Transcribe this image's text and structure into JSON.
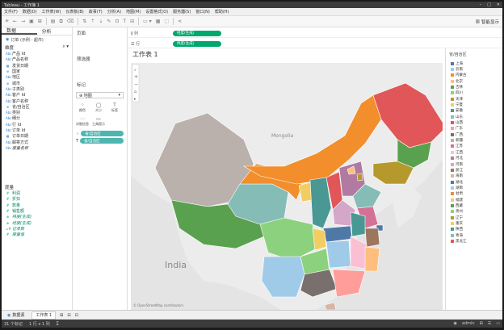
{
  "window": {
    "title": "Tableau - 工作簿 1",
    "controls": [
      "–",
      "□",
      "✕"
    ]
  },
  "menu": [
    "文件(F)",
    "数据(D)",
    "工作表(W)",
    "仪表板(B)",
    "故事(T)",
    "分析(A)",
    "地图(M)",
    "设置格式(O)",
    "服务器(S)",
    "窗口(N)",
    "帮助(H)"
  ],
  "toolbar": {
    "smart_show": "智能显示"
  },
  "data_pane": {
    "tab_data": "数据",
    "tab_analysis": "分析",
    "source": "订单 (示例 - 超市)",
    "dimensions_label": "维度",
    "dimensions": [
      {
        "name": "产品 Id",
        "icon": "Abc"
      },
      {
        "name": "产品名称",
        "icon": "Abc"
      },
      {
        "name": "发货日期",
        "icon": "▦"
      },
      {
        "name": "国家",
        "icon": "⊕"
      },
      {
        "name": "地区",
        "icon": "Abc"
      },
      {
        "name": "城市",
        "icon": "⊕"
      },
      {
        "name": "子类别",
        "icon": "Abc"
      },
      {
        "name": "客户 Id",
        "icon": "Abc"
      },
      {
        "name": "客户名称",
        "icon": "Abc"
      },
      {
        "name": "省/自治区",
        "icon": "⊕"
      },
      {
        "name": "类别",
        "icon": "Abc"
      },
      {
        "name": "细分",
        "icon": "Abc"
      },
      {
        "name": "行 Id",
        "icon": "Abc"
      },
      {
        "name": "订单 Id",
        "icon": "Abc"
      },
      {
        "name": "订单日期",
        "icon": "▦"
      },
      {
        "name": "邮寄方式",
        "icon": "Abc"
      },
      {
        "name": "度量名称",
        "icon": "Abc",
        "italic": true
      }
    ],
    "measures_label": "度量",
    "measures": [
      {
        "name": "利润",
        "icon": "#"
      },
      {
        "name": "折扣",
        "icon": "#"
      },
      {
        "name": "数量",
        "icon": "#"
      },
      {
        "name": "销售额",
        "icon": "#"
      },
      {
        "name": "纬度(生成)",
        "icon": "⊕",
        "italic": true
      },
      {
        "name": "经度(生成)",
        "icon": "⊕",
        "italic": true
      },
      {
        "name": "记录数",
        "icon": "=#",
        "italic": true
      },
      {
        "name": "度量值",
        "icon": "#",
        "italic": true
      }
    ]
  },
  "shelves": {
    "pages_label": "页面",
    "columns_label": "列",
    "columns_pill": "经度(生成)",
    "rows_label": "行",
    "rows_pill": "纬度(生成)",
    "filters_label": "筛选器",
    "marks_label": "标记",
    "marks_type": "地图",
    "mark_buttons": [
      {
        "label": "颜色",
        "icon": "⁘"
      },
      {
        "label": "大小",
        "icon": "◯"
      },
      {
        "label": "标签",
        "icon": "T"
      },
      {
        "label": "详细信息",
        "icon": "⋯"
      },
      {
        "label": "工具提示",
        "icon": "▭"
      }
    ],
    "mark_pills": [
      {
        "name": "省/自治区",
        "icon": "⁘"
      },
      {
        "name": "省/自治区",
        "icon": "T"
      }
    ]
  },
  "sheet": {
    "title": "工作表 1",
    "copyright": "© OpenStreetMap contributors"
  },
  "map_labels": {
    "mongolia": "Mongolia",
    "india": "India"
  },
  "legend": {
    "title": "省/自治区",
    "items": [
      {
        "name": "上海",
        "color": "#4e79a7"
      },
      {
        "name": "云南",
        "color": "#a0cbe8"
      },
      {
        "name": "内蒙古",
        "color": "#f28e2b"
      },
      {
        "name": "北京",
        "color": "#ffbe7d"
      },
      {
        "name": "吉林",
        "color": "#59a14f"
      },
      {
        "name": "四川",
        "color": "#8cd17d"
      },
      {
        "name": "天津",
        "color": "#b6992d"
      },
      {
        "name": "宁夏",
        "color": "#f1ce63"
      },
      {
        "name": "安徽",
        "color": "#499894"
      },
      {
        "name": "山东",
        "color": "#86bcb6"
      },
      {
        "name": "山西",
        "color": "#e15759"
      },
      {
        "name": "广东",
        "color": "#ff9d9a"
      },
      {
        "name": "广西",
        "color": "#79706e"
      },
      {
        "name": "新疆",
        "color": "#bab0ac"
      },
      {
        "name": "江苏",
        "color": "#d37295"
      },
      {
        "name": "江西",
        "color": "#fabfd2"
      },
      {
        "name": "河北",
        "color": "#b07aa1"
      },
      {
        "name": "河南",
        "color": "#d4a6c8"
      },
      {
        "name": "浙江",
        "color": "#9d7660"
      },
      {
        "name": "海南",
        "color": "#d7b5a6"
      },
      {
        "name": "湖北",
        "color": "#4e79a7"
      },
      {
        "name": "湖南",
        "color": "#a0cbe8"
      },
      {
        "name": "甘肃",
        "color": "#f28e2b"
      },
      {
        "name": "福建",
        "color": "#ffbe7d"
      },
      {
        "name": "西藏",
        "color": "#59a14f"
      },
      {
        "name": "贵州",
        "color": "#8cd17d"
      },
      {
        "name": "辽宁",
        "color": "#b6992d"
      },
      {
        "name": "重庆",
        "color": "#f1ce63"
      },
      {
        "name": "陕西",
        "color": "#499894"
      },
      {
        "name": "青海",
        "color": "#86bcb6"
      },
      {
        "name": "黑龙江",
        "color": "#e15759"
      }
    ]
  },
  "bottom_tabs": {
    "datasource": "数据源",
    "sheet": "工作表 1"
  },
  "status": {
    "marks": "31 个标记",
    "rowcol": "1 行 x 1 列",
    "user": "admin"
  }
}
